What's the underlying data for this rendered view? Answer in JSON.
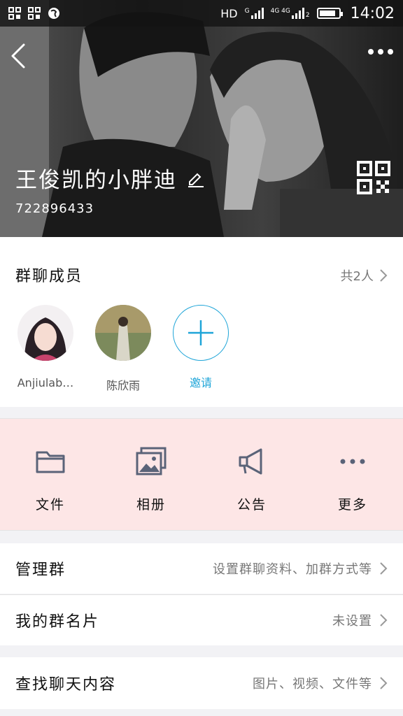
{
  "status_bar": {
    "network_label": "HD",
    "signal1_label": "G",
    "signal2_label": "4G 4G",
    "sim_index": "2",
    "time": "14:02",
    "battery_level": 0.85
  },
  "header": {
    "group_name": "王俊凯的小胖迪",
    "group_id": "722896433",
    "back_icon": "chevron-left-icon",
    "more_icon": "more-dots-icon",
    "edit_icon": "pencil-icon",
    "qr_icon": "qr-code-icon"
  },
  "members": {
    "title": "群聊成员",
    "count_text": "共2人",
    "list": [
      {
        "name": "Anjiulab…"
      },
      {
        "name": "陈欣雨"
      }
    ],
    "invite_label": "邀请"
  },
  "actions": [
    {
      "label": "文件",
      "icon": "folder-icon"
    },
    {
      "label": "相册",
      "icon": "photo-album-icon"
    },
    {
      "label": "公告",
      "icon": "megaphone-icon"
    },
    {
      "label": "更多",
      "icon": "more-horizontal-icon"
    }
  ],
  "settings": {
    "manage": {
      "title": "管理群",
      "value": "设置群聊资料、加群方式等"
    },
    "card": {
      "title": "我的群名片",
      "value": "未设置"
    },
    "search": {
      "title": "查找聊天内容",
      "value": "图片、视频、文件等"
    }
  },
  "colors": {
    "accent": "#1fa5d8",
    "action_bg": "#fde6e6"
  }
}
